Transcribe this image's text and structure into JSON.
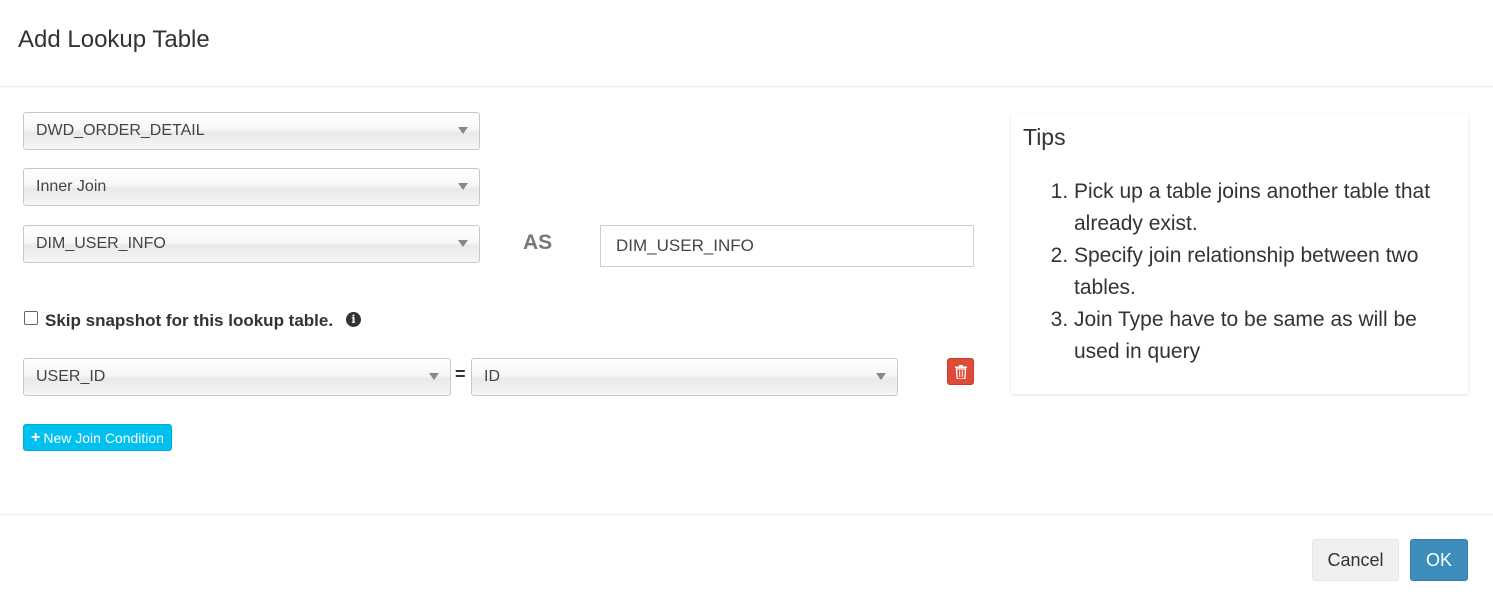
{
  "modal": {
    "title": "Add Lookup Table"
  },
  "form": {
    "source_table": "DWD_ORDER_DETAIL",
    "join_type": "Inner Join",
    "lookup_table": "DIM_USER_INFO",
    "as_label": "AS",
    "alias": "DIM_USER_INFO",
    "skip_snapshot_label": "Skip snapshot for this lookup table.",
    "skip_snapshot_checked": false,
    "join_conditions": [
      {
        "left_column": "USER_ID",
        "operator": "=",
        "right_column": "ID"
      }
    ],
    "new_join_condition_label": "New Join Condition"
  },
  "tips": {
    "title": "Tips",
    "items": [
      "Pick up a table joins another table that already exist.",
      "Specify join relationship between two tables.",
      "Join Type have to be same as will be used in query"
    ]
  },
  "footer": {
    "cancel_label": "Cancel",
    "ok_label": "OK"
  },
  "icons": {
    "info": "info-circle-icon",
    "delete": "trash-icon",
    "add": "plus-icon",
    "dropdown": "caret-down-icon"
  },
  "colors": {
    "primary": "#3c8dbc",
    "info": "#00c0ef",
    "danger": "#dd4b39"
  }
}
